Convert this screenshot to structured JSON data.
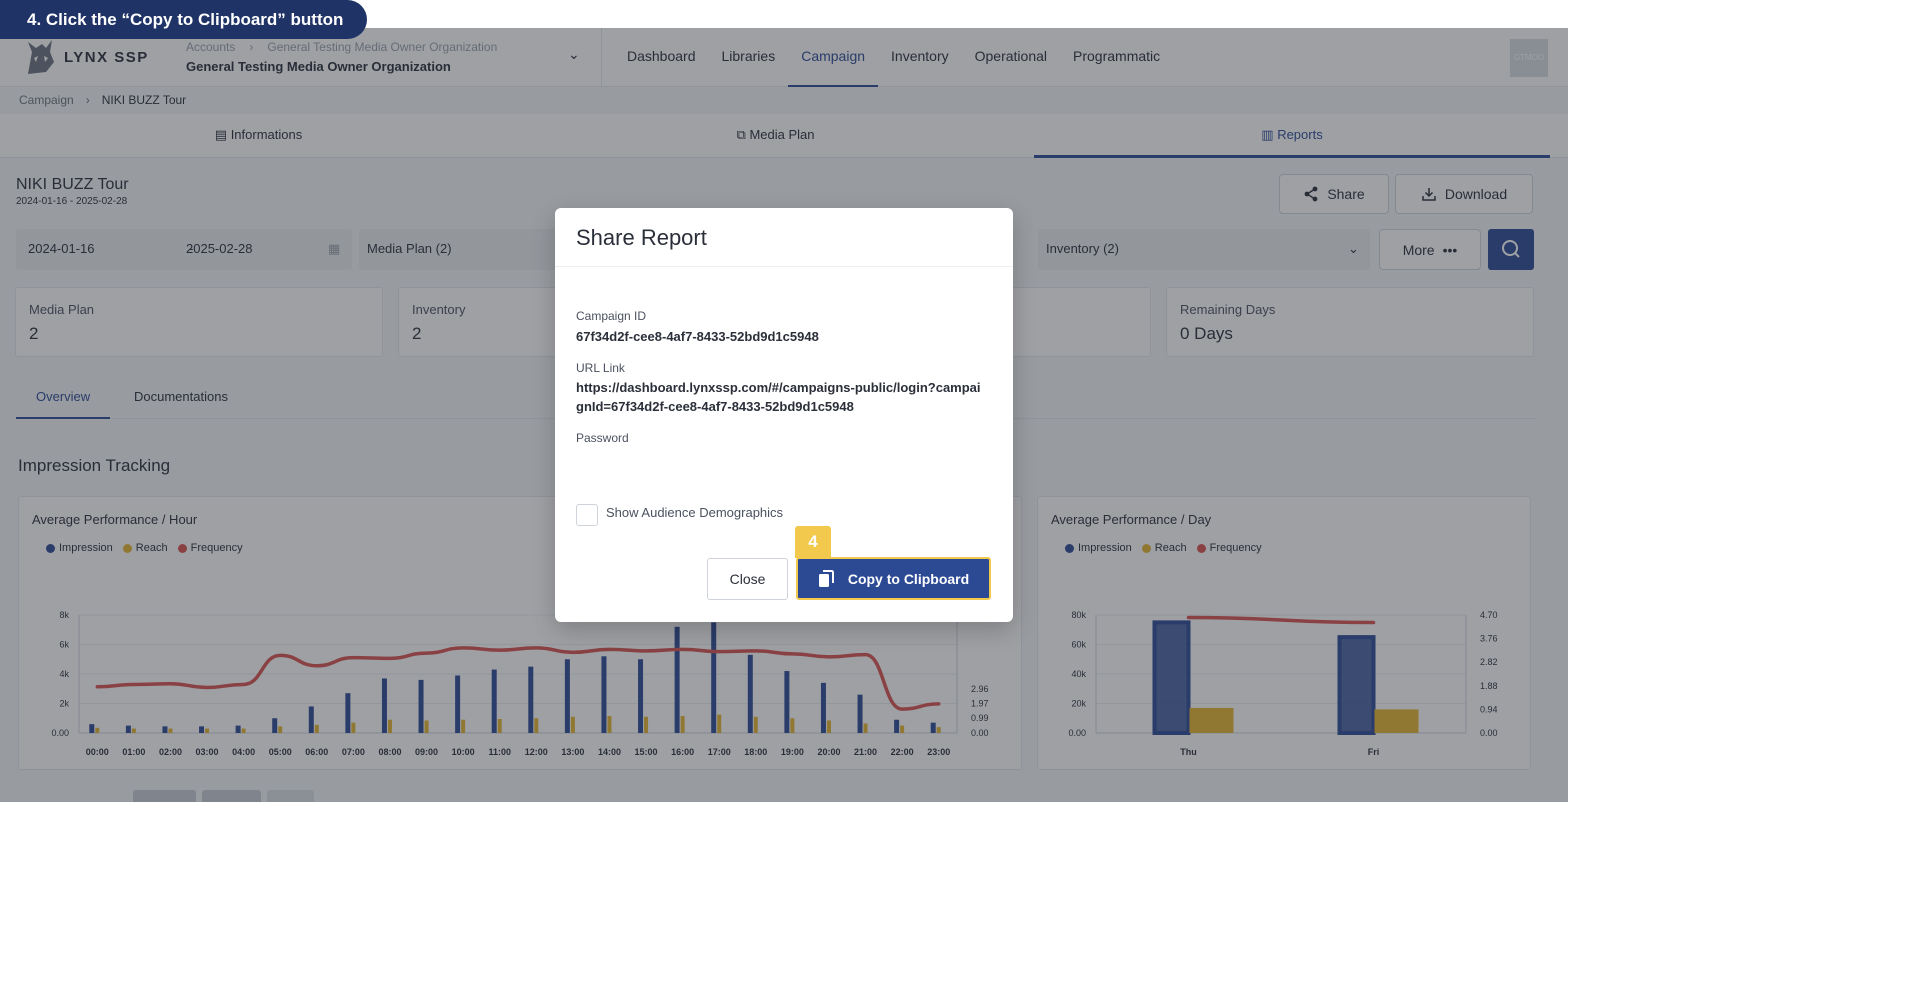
{
  "step_banner": {
    "text": "4. Click the “Copy to Clipboard” button"
  },
  "topnav": {
    "logo_text": "LYNX SSP",
    "crumbs": [
      "Accounts",
      "General Testing Media Owner Organization"
    ],
    "organization": "General Testing Media Owner Organization",
    "menu": [
      "Dashboard",
      "Libraries",
      "Campaign",
      "Inventory",
      "Operational",
      "Programmatic"
    ],
    "active_menu": "Campaign",
    "avatar_text": "GTMOO"
  },
  "breadcrumb": {
    "parent": "Campaign",
    "current": "NIKI BUZZ Tour"
  },
  "tabs": [
    "Informations",
    "Media Plan",
    "Reports"
  ],
  "active_tab": "Reports",
  "campaign": {
    "title": "NIKI BUZZ Tour",
    "dates": "2024-01-16 - 2025-02-28"
  },
  "actions": {
    "share": "Share",
    "download": "Download",
    "more": "More"
  },
  "filters": {
    "date_from": "2024-01-16",
    "date_sep": "-",
    "date_to": "2025-02-28",
    "media_plan": "Media Plan (2)",
    "inventory": "Inventory (2)"
  },
  "stats": [
    {
      "label": "Media Plan",
      "value": "2"
    },
    {
      "label": "Inventory",
      "value": "2"
    },
    {
      "label": "Remaining Days",
      "value": "0 Days"
    }
  ],
  "subtabs": [
    "Overview",
    "Documentations"
  ],
  "section_title": "Impression Tracking",
  "legend": [
    "Impression",
    "Reach",
    "Frequency"
  ],
  "colors": {
    "impression": "#2c4a94",
    "reach": "#e8b730",
    "frequency": "#d9534f",
    "accent": "#2c4a94",
    "highlight": "#f2c94c"
  },
  "chart_data": [
    {
      "type": "bar",
      "title": "Average Performance / Hour",
      "categories": [
        "00:00",
        "01:00",
        "02:00",
        "03:00",
        "04:00",
        "05:00",
        "06:00",
        "07:00",
        "08:00",
        "09:00",
        "10:00",
        "11:00",
        "12:00",
        "13:00",
        "14:00",
        "15:00",
        "16:00",
        "17:00",
        "18:00",
        "19:00",
        "20:00",
        "21:00",
        "22:00",
        "23:00"
      ],
      "series": [
        {
          "name": "Impression",
          "values": [
            600,
            500,
            450,
            450,
            500,
            1000,
            1800,
            2700,
            3700,
            3600,
            3900,
            4300,
            4500,
            5000,
            5200,
            5000,
            7200,
            7500,
            5300,
            4200,
            3400,
            2600,
            900,
            700
          ]
        },
        {
          "name": "Reach",
          "values": [
            350,
            300,
            300,
            300,
            300,
            450,
            550,
            700,
            900,
            850,
            900,
            950,
            1000,
            1100,
            1150,
            1100,
            1150,
            1250,
            1100,
            1000,
            850,
            650,
            500,
            400
          ]
        },
        {
          "name": "Frequency",
          "values": [
            3.1,
            3.25,
            3.3,
            3.05,
            3.25,
            5.2,
            4.5,
            5.05,
            5.0,
            5.35,
            5.7,
            5.55,
            5.7,
            5.4,
            5.6,
            5.5,
            5.6,
            5.45,
            5.5,
            5.3,
            5.1,
            5.25,
            1.6,
            1.95
          ]
        }
      ],
      "y_ticks_left": [
        "0.00",
        "2k",
        "4k",
        "6k",
        "8k"
      ],
      "y_ticks_right": [
        "0.00",
        "0.99",
        "1.97",
        "2.96"
      ],
      "ylim": [
        0,
        8000
      ]
    },
    {
      "type": "bar",
      "title": "Average Performance / Day",
      "categories": [
        "Thu",
        "Fri"
      ],
      "series": [
        {
          "name": "Impression",
          "values": [
            75000,
            65000
          ]
        },
        {
          "name": "Reach",
          "values": [
            17000,
            16000
          ]
        },
        {
          "name": "Frequency",
          "values": [
            4.6,
            4.4
          ]
        }
      ],
      "y_ticks_left": [
        "0.00",
        "20k",
        "40k",
        "60k",
        "80k"
      ],
      "y_ticks_right": [
        "0.00",
        "0.94",
        "1.88",
        "2.82",
        "3.76",
        "4.70"
      ],
      "ylim": [
        0,
        80000
      ]
    }
  ],
  "modal": {
    "title": "Share Report",
    "campaign_id_label": "Campaign ID",
    "campaign_id": "67f34d2f-cee8-4af7-8433-52bd9d1c5948",
    "url_label": "URL Link",
    "url": "https://dashboard.lynxssp.com/#/campaigns-public/login?campaignId=67f34d2f-cee8-4af7-8433-52bd9d1c5948",
    "password_label": "Password",
    "checkbox_label": "Show Audience Demographics",
    "checkbox_checked": false,
    "close_label": "Close",
    "copy_label": "Copy to Clipboard",
    "step_badge": "4"
  }
}
